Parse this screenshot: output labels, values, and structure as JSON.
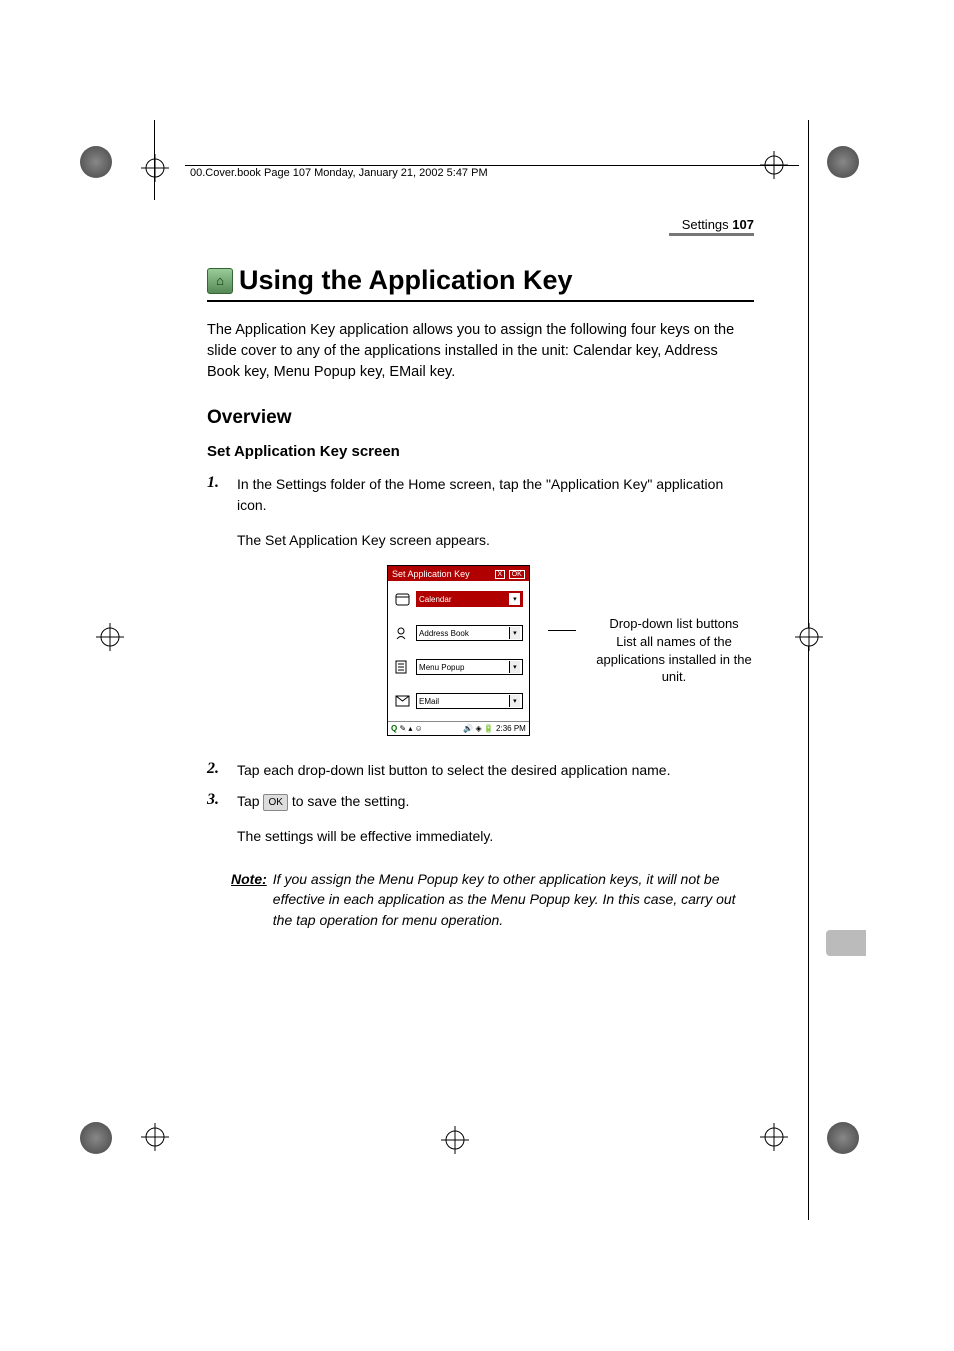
{
  "book_tag": "00.Cover.book  Page 107  Monday, January 21, 2002  5:47 PM",
  "header": {
    "section": "Settings",
    "page_number": "107"
  },
  "title": "Using the Application Key",
  "intro": "The Application Key application allows you to assign the following four keys on the slide cover to any of the applications installed in the unit: Calendar key, Address Book key, Menu Popup key, EMail key.",
  "overview_heading": "Overview",
  "sub_heading": "Set Application Key screen",
  "steps": [
    {
      "num": "1.",
      "text": "In the Settings folder of the Home screen, tap the \"Application Key\" application icon.",
      "after": "The Set Application Key screen appears."
    },
    {
      "num": "2.",
      "text": "Tap each drop-down list button to select the desired application name."
    },
    {
      "num": "3.",
      "text_pre": "Tap ",
      "ok_label": "OK",
      "text_post": " to save the setting.",
      "after": "The settings will be effective immediately."
    }
  ],
  "pda": {
    "title": "Set Application Key",
    "title_buttons": [
      "X",
      "OK"
    ],
    "rows": [
      {
        "icon": "calendar",
        "value": "Calendar",
        "active": true
      },
      {
        "icon": "addressbook",
        "value": "Address Book",
        "active": false
      },
      {
        "icon": "menu",
        "value": "Menu Popup",
        "active": false
      },
      {
        "icon": "email",
        "value": "EMail",
        "active": false
      }
    ],
    "taskbar_time": "2:36 PM"
  },
  "annotation": {
    "line1": "Drop-down list buttons",
    "line2": "List all names of the applications installed in the unit."
  },
  "note": {
    "label": "Note:",
    "text": "If you assign the Menu Popup key to other application keys, it will not be effective in each application as the Menu Popup key. In this case, carry out the tap operation for menu operation."
  }
}
